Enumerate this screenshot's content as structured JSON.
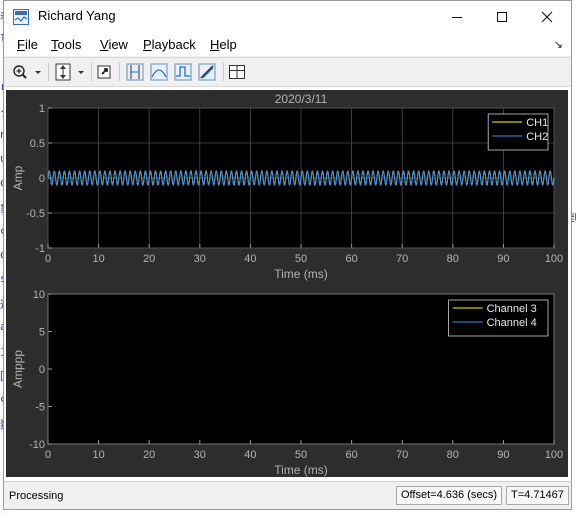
{
  "window": {
    "title": "Richard Yang"
  },
  "menu": [
    "File",
    "Tools",
    "View",
    "Playback",
    "Help"
  ],
  "background": {
    "side_glyphs": [
      "着",
      "ld",
      "ト",
      "r",
      "ク",
      "n",
      "ut",
      "ol",
      "象",
      "ce",
      "ol",
      "s",
      "運",
      "at",
      "ja",
      "回",
      "ce",
      "数"
    ],
    "right_glyph": "到"
  },
  "status": {
    "left": "Processing",
    "offset": "Offset=4.636 (secs)",
    "time": "T=4.71467"
  },
  "colors": {
    "figure_bg": "#2d2d2d",
    "axes_bg": "#000000",
    "axis_text": "#b4b4b4",
    "grid": "#4a4a4a",
    "series_yellow": "#ffff00",
    "series_blue": "#3c8cf0"
  },
  "chart_data": [
    {
      "type": "line",
      "title": "2020/3/11",
      "xlabel": "Time (ms)",
      "ylabel": "Amp",
      "xlim": [
        0,
        100
      ],
      "ylim": [
        -1,
        1
      ],
      "xticks": [
        "0",
        "10",
        "20",
        "30",
        "40",
        "50",
        "60",
        "70",
        "80",
        "90",
        "100"
      ],
      "yticks": [
        "1",
        "0.5",
        "0",
        "-0.5",
        "-1"
      ],
      "grid": true,
      "legend_position": "top-right",
      "series": [
        {
          "name": "CH1",
          "color": "#ffff00",
          "shape": "sine",
          "amplitude": 0.1,
          "cycles": 100,
          "phase": 0,
          "offset": 0
        },
        {
          "name": "CH2",
          "color": "#3c8cf0",
          "shape": "sine",
          "amplitude": 0.1,
          "cycles": 100,
          "phase": 0,
          "offset": 0
        }
      ]
    },
    {
      "type": "line",
      "title": "",
      "xlabel": "Time (ms)",
      "ylabel": "Amppp",
      "xlim": [
        0,
        100
      ],
      "ylim": [
        -10,
        10
      ],
      "xticks": [
        "0",
        "10",
        "20",
        "30",
        "40",
        "50",
        "60",
        "70",
        "80",
        "90",
        "100"
      ],
      "yticks": [
        "10",
        "5",
        "0",
        "-5",
        "-10"
      ],
      "grid": false,
      "legend_position": "top-right",
      "series": [
        {
          "name": "Channel 3",
          "color": "#ffff00",
          "points": []
        },
        {
          "name": "Channel 4",
          "color": "#3c8cf0",
          "points": []
        }
      ]
    }
  ]
}
